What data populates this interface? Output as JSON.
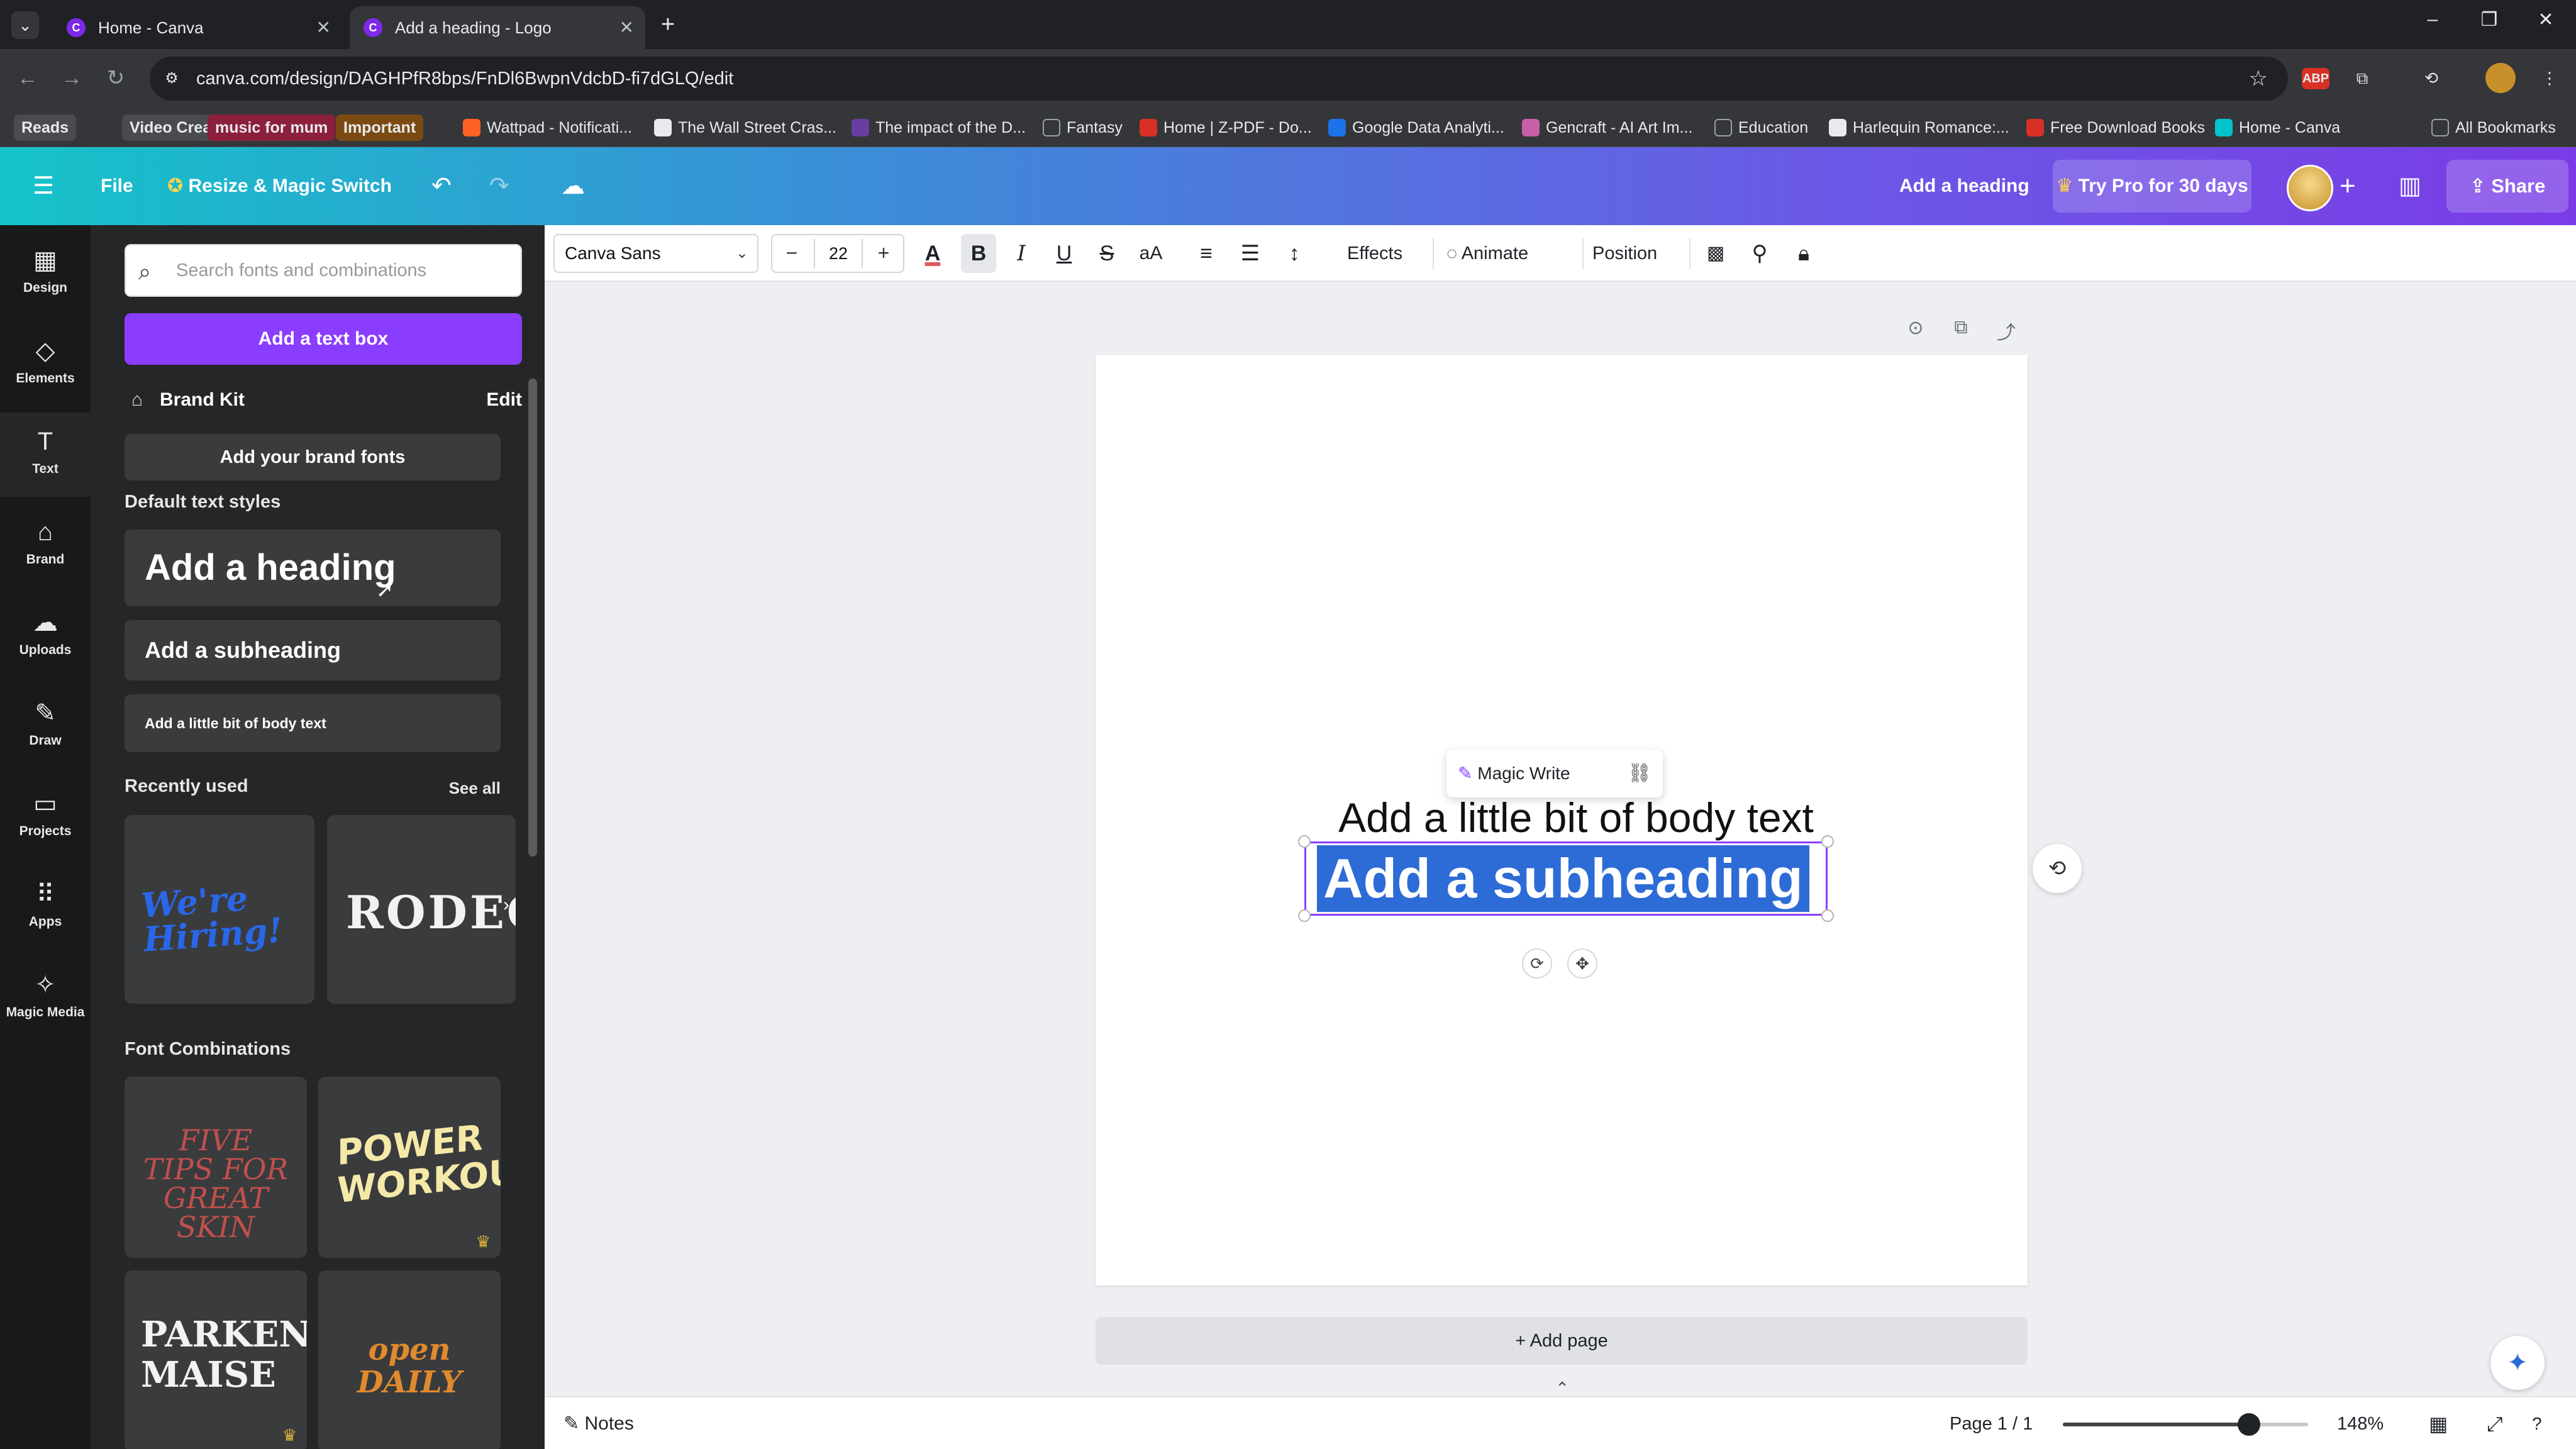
{
  "browser": {
    "tabs": [
      {
        "title": "Home - Canva",
        "active": false
      },
      {
        "title": "Add a heading - Logo",
        "active": true
      }
    ],
    "url": "canva.com/design/DAGHPfR8bps/FnDl6BwpnVdcbD-fi7dGLQ/edit",
    "bookmarks": [
      {
        "label": "Reads",
        "style": "pill",
        "color": "#4a4b4f"
      },
      {
        "label": "Video Creation",
        "style": "pill",
        "color": "#4a4b4f"
      },
      {
        "label": "music for mum",
        "style": "pill",
        "color": "#8b1f3c"
      },
      {
        "label": "Important",
        "style": "pill",
        "color": "#7a4a12"
      },
      {
        "label": "Wattpad - Notificati...",
        "style": "icon",
        "color": "#ff6122"
      },
      {
        "label": "The Wall Street Cras...",
        "style": "icon",
        "color": "#e8eaed"
      },
      {
        "label": "The impact of the D...",
        "style": "icon",
        "color": "#6a3ea1"
      },
      {
        "label": "Fantasy",
        "style": "folder",
        "color": "#9aa0a6"
      },
      {
        "label": "Home | Z-PDF - Do...",
        "style": "icon",
        "color": "#d93025"
      },
      {
        "label": "Google Data Analyti...",
        "style": "icon",
        "color": "#1a73e8"
      },
      {
        "label": "Gencraft - AI Art Im...",
        "style": "icon",
        "color": "#c85fa8"
      },
      {
        "label": "Education",
        "style": "folder",
        "color": "#9aa0a6"
      },
      {
        "label": "Harlequin Romance:...",
        "style": "icon",
        "color": "#e8eaed"
      },
      {
        "label": "Free Download Books",
        "style": "icon",
        "color": "#d93025"
      },
      {
        "label": "Home - Canva",
        "style": "icon",
        "color": "#00c4cc"
      }
    ],
    "all_bookmarks": "All Bookmarks"
  },
  "canva_header": {
    "file": "File",
    "resize": "Resize & Magic Switch",
    "design_title": "Add a heading",
    "try_pro": "Try Pro for 30 days",
    "share": "Share"
  },
  "rail": [
    {
      "label": "Design",
      "icon": "design-icon",
      "glyph": "▦"
    },
    {
      "label": "Elements",
      "icon": "elements-icon",
      "glyph": "◇"
    },
    {
      "label": "Text",
      "icon": "text-icon",
      "glyph": "T",
      "active": true
    },
    {
      "label": "Brand",
      "icon": "brand-icon",
      "glyph": "⌂"
    },
    {
      "label": "Uploads",
      "icon": "uploads-icon",
      "glyph": "☁"
    },
    {
      "label": "Draw",
      "icon": "draw-icon",
      "glyph": "✎"
    },
    {
      "label": "Projects",
      "icon": "projects-icon",
      "glyph": "▭"
    },
    {
      "label": "Apps",
      "icon": "apps-icon",
      "glyph": "⠿"
    },
    {
      "label": "Magic Media",
      "icon": "magic-media-icon",
      "glyph": "✧"
    }
  ],
  "panel": {
    "search_placeholder": "Search fonts and combinations",
    "add_text_box": "Add a text box",
    "brand_kit": "Brand Kit",
    "edit": "Edit",
    "add_brand_fonts": "Add your brand fonts",
    "default_styles_title": "Default text styles",
    "heading": "Add a heading",
    "subheading": "Add a subheading",
    "body": "Add a little bit of body text",
    "recently_used": "Recently used",
    "see_all": "See all",
    "recent": [
      "We're Hiring!",
      "RODEO"
    ],
    "font_combinations": "Font Combinations",
    "combos": [
      "FIVE TIPS FOR GREAT SKIN",
      "POWER WORKOUT",
      "PARKEN MAISE",
      "open DAILY"
    ]
  },
  "toolbar": {
    "font": "Canva Sans",
    "size": "22",
    "effects": "Effects",
    "animate": "Animate",
    "position": "Position"
  },
  "canvas": {
    "magic_write": "Magic Write",
    "body_text": "Add a little bit of body text",
    "subheading": "Add a subheading",
    "add_page": "+ Add page"
  },
  "footer": {
    "notes": "Notes",
    "page": "Page 1 / 1",
    "zoom": "148%",
    "zoom_fraction": 0.76
  },
  "colors": {
    "accent": "#8b3dff",
    "selection": "#2d6bd6"
  }
}
